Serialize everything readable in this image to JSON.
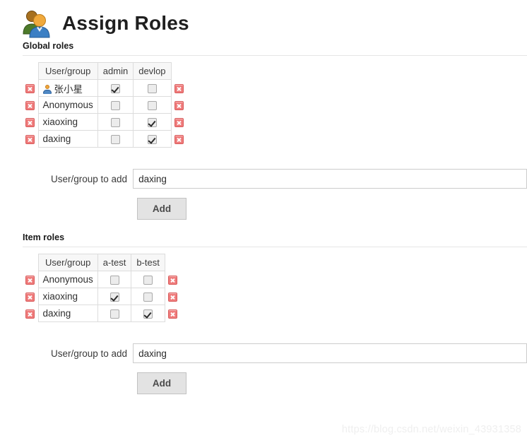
{
  "header": {
    "title": "Assign Roles",
    "icon": "people-icon"
  },
  "global_roles": {
    "section_title": "Global roles",
    "columns": [
      "User/group",
      "admin",
      "devlop"
    ],
    "rows": [
      {
        "name": "张小星",
        "has_avatar": true,
        "checks": [
          true,
          false
        ]
      },
      {
        "name": "Anonymous",
        "has_avatar": false,
        "checks": [
          false,
          false
        ]
      },
      {
        "name": "xiaoxing",
        "has_avatar": false,
        "checks": [
          false,
          true
        ]
      },
      {
        "name": "daxing",
        "has_avatar": false,
        "checks": [
          false,
          true
        ]
      }
    ],
    "add": {
      "label": "User/group to add",
      "value": "daxing",
      "placeholder": "",
      "button_label": "Add"
    }
  },
  "item_roles": {
    "section_title": "Item roles",
    "columns": [
      "User/group",
      "a-test",
      "b-test"
    ],
    "rows": [
      {
        "name": "Anonymous",
        "has_avatar": false,
        "checks": [
          false,
          false
        ]
      },
      {
        "name": "xiaoxing",
        "has_avatar": false,
        "checks": [
          true,
          false
        ]
      },
      {
        "name": "daxing",
        "has_avatar": false,
        "checks": [
          false,
          true
        ]
      }
    ],
    "add": {
      "label": "User/group to add",
      "value": "daxing",
      "placeholder": "",
      "button_label": "Add"
    }
  },
  "watermark": {
    "text": "https://blog.csdn.net/weixin_43931358"
  },
  "colors": {
    "delete_icon": "#ef7b7b",
    "header_bg": "#f7f7f7",
    "border": "#dcdcdc",
    "button_bg": "#e3e3e3"
  }
}
